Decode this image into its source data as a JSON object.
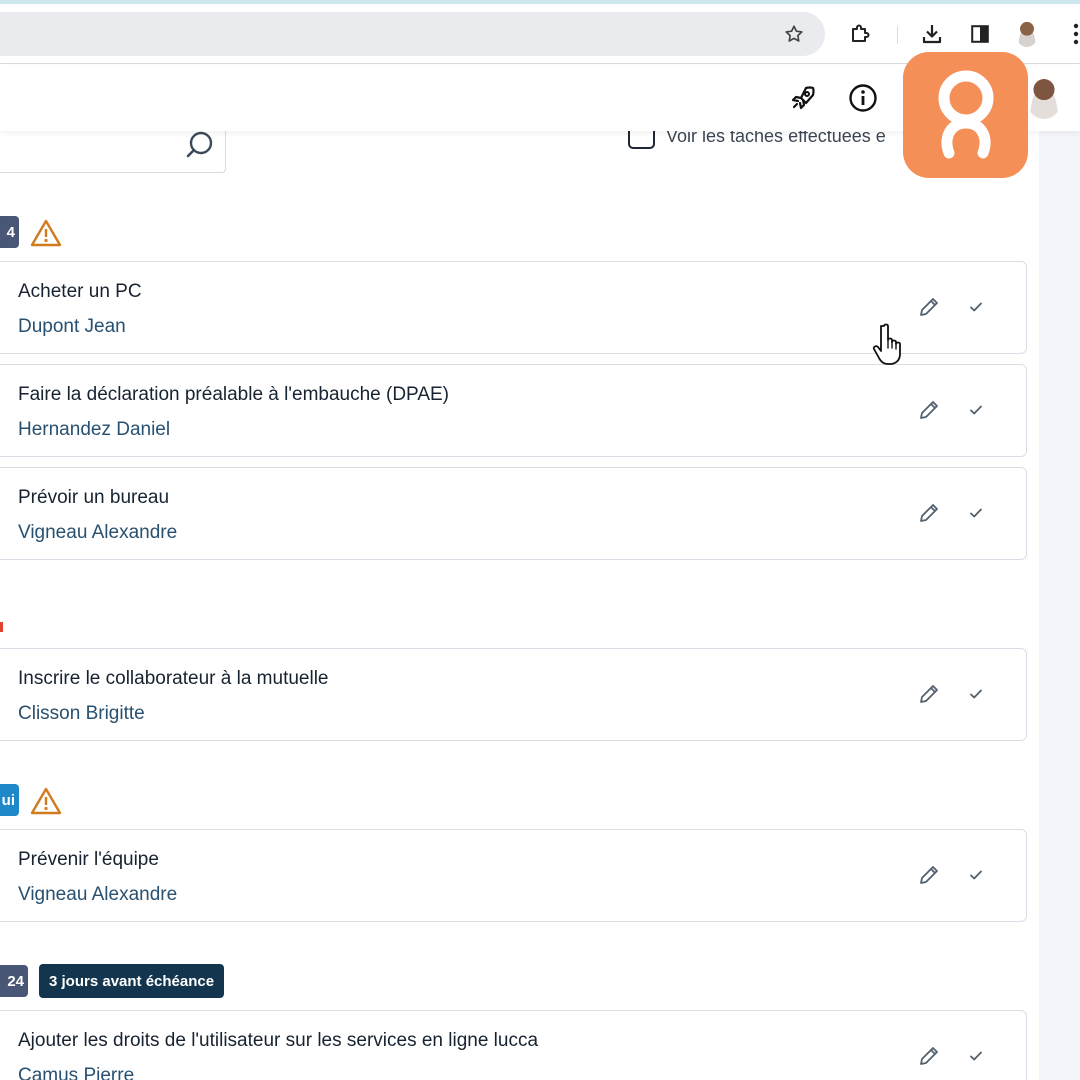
{
  "browser": {
    "toolbar_icons": [
      "star-icon",
      "extension-icon",
      "download-icon",
      "side-panel-icon",
      "profile-avatar",
      "more-icon"
    ]
  },
  "header": {
    "icons": [
      "rocket-icon",
      "info-icon",
      "user-avatar"
    ]
  },
  "brand": {
    "logo": "lucca-logo",
    "color": "#f48f58"
  },
  "filters": {
    "search_icon": "search-icon",
    "done_label": "Voir les tâches effectuées e",
    "done_checked": false
  },
  "colors": {
    "date_chip_dark": "#4a5676",
    "date_chip_blue": "#1f88c9",
    "badge": "#13354d",
    "warning": "#d17a1e"
  },
  "groups": [
    {
      "date_chip": "4",
      "warning": true,
      "tasks": [
        {
          "title": "Acheter un PC",
          "person": "Dupont Jean"
        },
        {
          "title": "Faire la déclaration préalable à l'embauche (DPAE)",
          "person": "Hernandez Daniel"
        },
        {
          "title": "Prévoir un bureau",
          "person": "Vigneau Alexandre"
        }
      ]
    },
    {
      "date_chip": "",
      "warning": false,
      "tasks": [
        {
          "title": "Inscrire le collaborateur à la mutuelle",
          "person": "Clisson Brigitte"
        }
      ]
    },
    {
      "date_chip": "ui",
      "warning": true,
      "tasks": [
        {
          "title": "Prévenir l'équipe",
          "person": "Vigneau Alexandre"
        }
      ]
    },
    {
      "date_chip": "24",
      "badge": "3 jours avant échéance",
      "warning": false,
      "tasks": [
        {
          "title": "Ajouter les droits de l'utilisateur sur les services en ligne lucca",
          "person": "Camus Pierre"
        }
      ]
    }
  ]
}
